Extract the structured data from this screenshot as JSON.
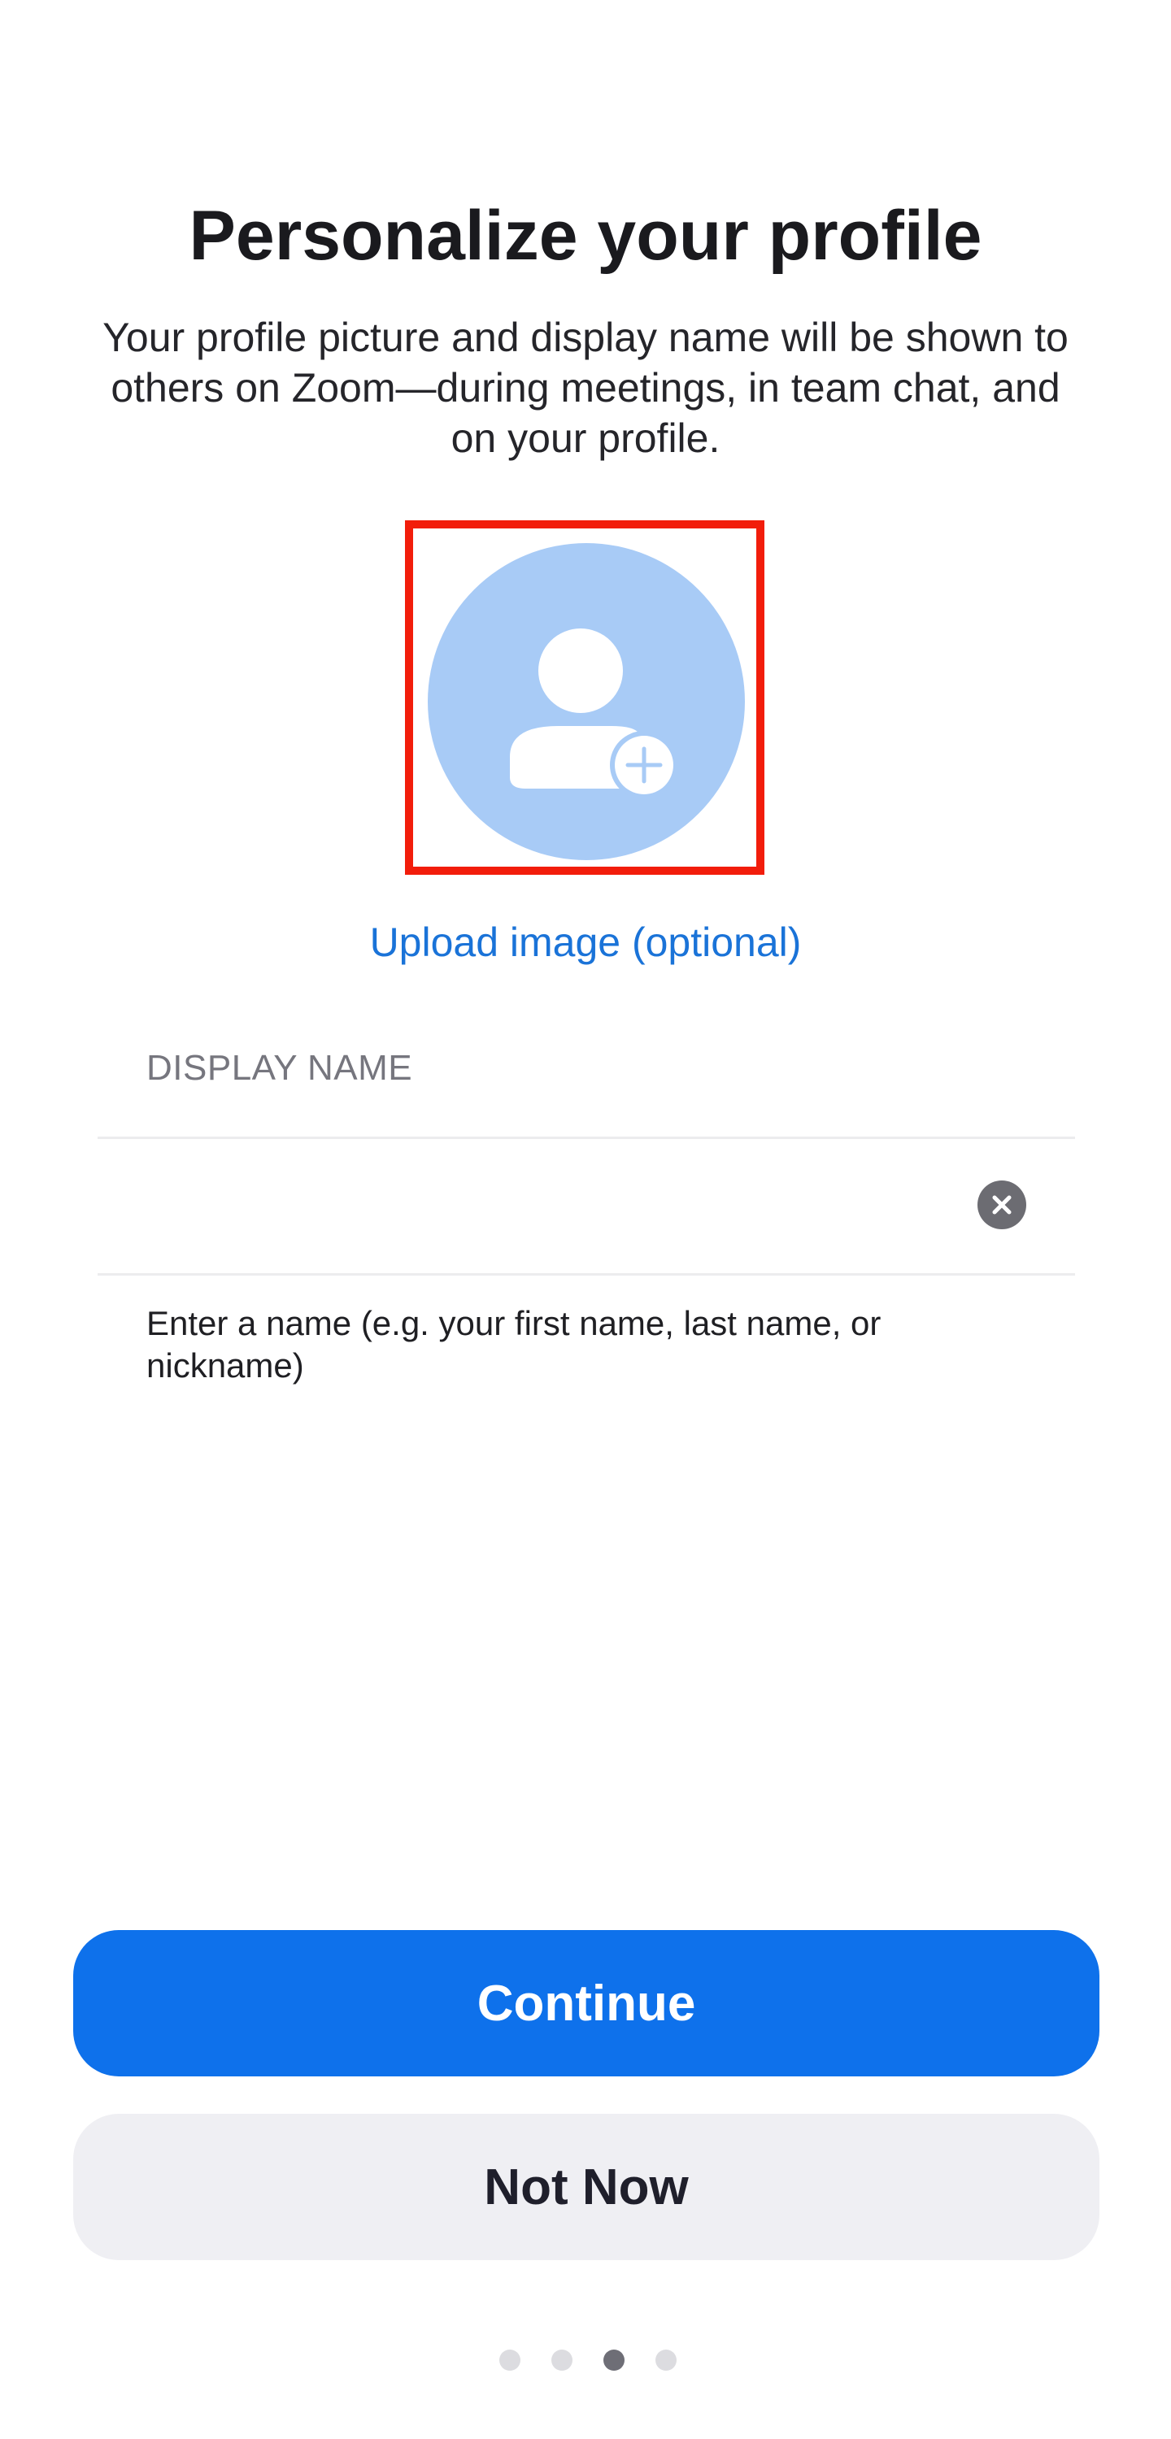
{
  "header": {
    "title": "Personalize your profile",
    "subtitle": "Your profile picture and display name will be shown to others on Zoom—during meetings, in team chat, and on your profile."
  },
  "avatar": {
    "icon": "person-add-icon",
    "color": "#a8cbf6",
    "upload_label": "Upload image (optional)"
  },
  "display_name": {
    "section_label": "DISPLAY NAME",
    "value": "",
    "clear_icon": "clear-icon",
    "helper_text": "Enter a name (e.g. your first name, last name, or nickname)"
  },
  "actions": {
    "continue_label": "Continue",
    "not_now_label": "Not Now"
  },
  "pagination": {
    "total_pages": 4,
    "current_page": 3
  },
  "colors": {
    "primary": "#0e71eb",
    "link": "#1a73d8",
    "highlight_border": "#f21d0b"
  }
}
